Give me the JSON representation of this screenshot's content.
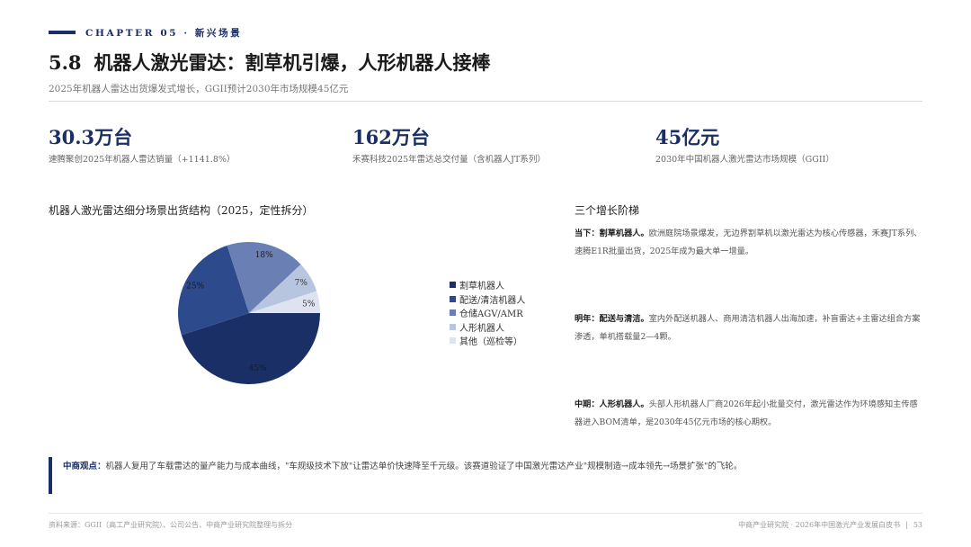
{
  "header": {
    "chapter": "CHAPTER 05 · 新兴场景",
    "section_number": "5.8",
    "title": "机器人激光雷达：割草机引爆，人形机器人接棒",
    "subtitle": "2025年机器人雷达出货爆发式增长，GGII预计2030年市场规模45亿元"
  },
  "kpis": [
    {
      "value": "30.3万台",
      "label": "速腾聚创2025年机器人雷达销量（+1141.8%）"
    },
    {
      "value": "162万台",
      "label": "禾赛科技2025年雷达总交付量（含机器人JT系列）"
    },
    {
      "value": "45亿元",
      "label": "2030年中国机器人激光雷达市场规模（GGII）"
    }
  ],
  "chart_data": {
    "type": "pie",
    "title": "机器人激光雷达细分场景出货结构（2025，定性拆分）",
    "categories": [
      "割草机器人",
      "配送/清洁机器人",
      "仓储AGV/AMR",
      "人形机器人",
      "其他（巡检等）"
    ],
    "values": [
      45,
      25,
      18,
      7,
      5
    ],
    "data_labels": [
      "45%",
      "25%",
      "18%",
      "7%",
      "5%"
    ],
    "colors": [
      "#1a2f66",
      "#2c4a8c",
      "#6a80b4",
      "#b8c5df",
      "#dde3ef"
    ],
    "legend_position": "right"
  },
  "stages": {
    "title": "三个增长阶梯",
    "items": [
      {
        "head": "当下：割草机器人。",
        "body": "欧洲庭院场景爆发，无边界割草机以激光雷达为核心传感器，禾赛JT系列、速腾E1R批量出货，2025年成为最大单一增量。"
      },
      {
        "head": "明年：配送与清洁。",
        "body": "室内外配送机器人、商用清洁机器人出海加速，补盲雷达+主雷达组合方案渗透，单机搭载量2—4颗。"
      },
      {
        "head": "中期：人形机器人。",
        "body": "头部人形机器人厂商2026年起小批量交付，激光雷达作为环境感知主传感器进入BOM清单，是2030年45亿元市场的核心期权。"
      }
    ]
  },
  "quote": {
    "head": "中商观点：",
    "body": "机器人复用了车载雷达的量产能力与成本曲线，\"车规级技术下放\"让雷达单价快速降至千元级。该赛道验证了中国激光雷达产业\"规模制造→成本领先→场景扩张\"的飞轮。"
  },
  "footer": {
    "source": "资料来源：GGII（高工产业研究院）、公司公告、中商产业研究院整理与拆分",
    "publication": "中商产业研究院 · 2026年中国激光产业发展白皮书",
    "separator": "|",
    "page": "53"
  }
}
